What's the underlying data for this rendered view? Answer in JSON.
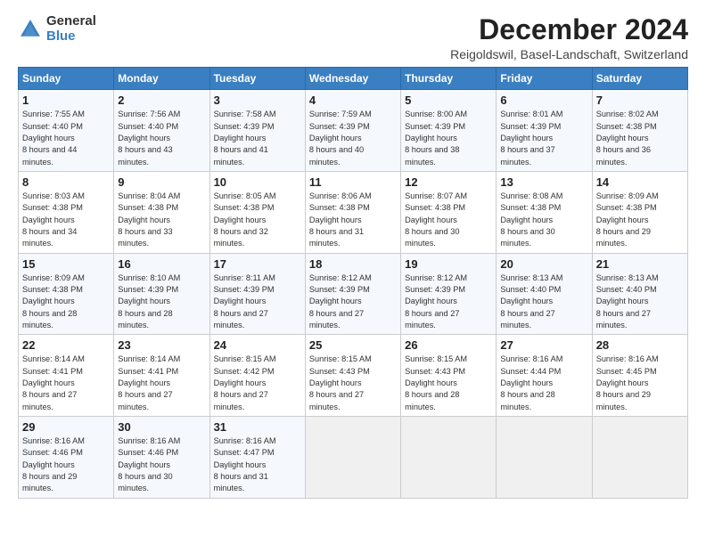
{
  "logo": {
    "general": "General",
    "blue": "Blue"
  },
  "title": "December 2024",
  "location": "Reigoldswil, Basel-Landschaft, Switzerland",
  "headers": [
    "Sunday",
    "Monday",
    "Tuesday",
    "Wednesday",
    "Thursday",
    "Friday",
    "Saturday"
  ],
  "weeks": [
    [
      {
        "day": "1",
        "rise": "7:55 AM",
        "set": "4:40 PM",
        "daylight": "8 hours and 44 minutes."
      },
      {
        "day": "2",
        "rise": "7:56 AM",
        "set": "4:40 PM",
        "daylight": "8 hours and 43 minutes."
      },
      {
        "day": "3",
        "rise": "7:58 AM",
        "set": "4:39 PM",
        "daylight": "8 hours and 41 minutes."
      },
      {
        "day": "4",
        "rise": "7:59 AM",
        "set": "4:39 PM",
        "daylight": "8 hours and 40 minutes."
      },
      {
        "day": "5",
        "rise": "8:00 AM",
        "set": "4:39 PM",
        "daylight": "8 hours and 38 minutes."
      },
      {
        "day": "6",
        "rise": "8:01 AM",
        "set": "4:39 PM",
        "daylight": "8 hours and 37 minutes."
      },
      {
        "day": "7",
        "rise": "8:02 AM",
        "set": "4:38 PM",
        "daylight": "8 hours and 36 minutes."
      }
    ],
    [
      {
        "day": "8",
        "rise": "8:03 AM",
        "set": "4:38 PM",
        "daylight": "8 hours and 34 minutes."
      },
      {
        "day": "9",
        "rise": "8:04 AM",
        "set": "4:38 PM",
        "daylight": "8 hours and 33 minutes."
      },
      {
        "day": "10",
        "rise": "8:05 AM",
        "set": "4:38 PM",
        "daylight": "8 hours and 32 minutes."
      },
      {
        "day": "11",
        "rise": "8:06 AM",
        "set": "4:38 PM",
        "daylight": "8 hours and 31 minutes."
      },
      {
        "day": "12",
        "rise": "8:07 AM",
        "set": "4:38 PM",
        "daylight": "8 hours and 30 minutes."
      },
      {
        "day": "13",
        "rise": "8:08 AM",
        "set": "4:38 PM",
        "daylight": "8 hours and 30 minutes."
      },
      {
        "day": "14",
        "rise": "8:09 AM",
        "set": "4:38 PM",
        "daylight": "8 hours and 29 minutes."
      }
    ],
    [
      {
        "day": "15",
        "rise": "8:09 AM",
        "set": "4:38 PM",
        "daylight": "8 hours and 28 minutes."
      },
      {
        "day": "16",
        "rise": "8:10 AM",
        "set": "4:39 PM",
        "daylight": "8 hours and 28 minutes."
      },
      {
        "day": "17",
        "rise": "8:11 AM",
        "set": "4:39 PM",
        "daylight": "8 hours and 27 minutes."
      },
      {
        "day": "18",
        "rise": "8:12 AM",
        "set": "4:39 PM",
        "daylight": "8 hours and 27 minutes."
      },
      {
        "day": "19",
        "rise": "8:12 AM",
        "set": "4:39 PM",
        "daylight": "8 hours and 27 minutes."
      },
      {
        "day": "20",
        "rise": "8:13 AM",
        "set": "4:40 PM",
        "daylight": "8 hours and 27 minutes."
      },
      {
        "day": "21",
        "rise": "8:13 AM",
        "set": "4:40 PM",
        "daylight": "8 hours and 27 minutes."
      }
    ],
    [
      {
        "day": "22",
        "rise": "8:14 AM",
        "set": "4:41 PM",
        "daylight": "8 hours and 27 minutes."
      },
      {
        "day": "23",
        "rise": "8:14 AM",
        "set": "4:41 PM",
        "daylight": "8 hours and 27 minutes."
      },
      {
        "day": "24",
        "rise": "8:15 AM",
        "set": "4:42 PM",
        "daylight": "8 hours and 27 minutes."
      },
      {
        "day": "25",
        "rise": "8:15 AM",
        "set": "4:43 PM",
        "daylight": "8 hours and 27 minutes."
      },
      {
        "day": "26",
        "rise": "8:15 AM",
        "set": "4:43 PM",
        "daylight": "8 hours and 28 minutes."
      },
      {
        "day": "27",
        "rise": "8:16 AM",
        "set": "4:44 PM",
        "daylight": "8 hours and 28 minutes."
      },
      {
        "day": "28",
        "rise": "8:16 AM",
        "set": "4:45 PM",
        "daylight": "8 hours and 29 minutes."
      }
    ],
    [
      {
        "day": "29",
        "rise": "8:16 AM",
        "set": "4:46 PM",
        "daylight": "8 hours and 29 minutes."
      },
      {
        "day": "30",
        "rise": "8:16 AM",
        "set": "4:46 PM",
        "daylight": "8 hours and 30 minutes."
      },
      {
        "day": "31",
        "rise": "8:16 AM",
        "set": "4:47 PM",
        "daylight": "8 hours and 31 minutes."
      },
      null,
      null,
      null,
      null
    ]
  ]
}
